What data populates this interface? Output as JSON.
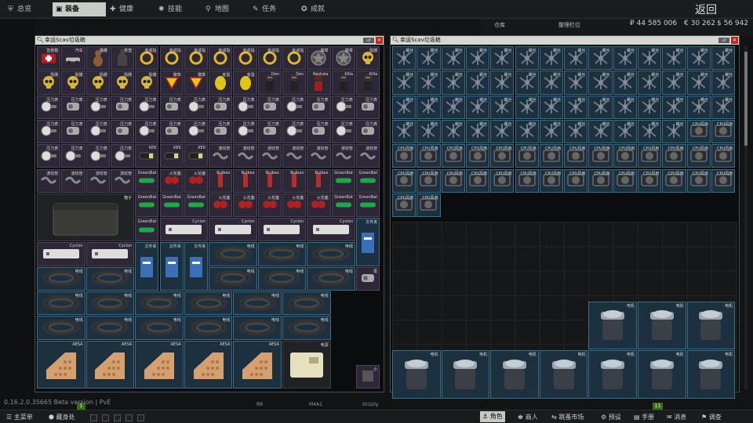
{
  "topbar": {
    "tabs": [
      {
        "label": "总览",
        "icon": "shield-icon"
      },
      {
        "label": "装备",
        "icon": "shirt-icon"
      },
      {
        "label": "健康",
        "icon": "health-icon"
      },
      {
        "label": "技能",
        "icon": "skills-icon"
      },
      {
        "label": "地图",
        "icon": "map-pin-icon"
      },
      {
        "label": "任务",
        "icon": "tasks-icon"
      },
      {
        "label": "成就",
        "icon": "achievements-icon"
      }
    ],
    "back": "返回"
  },
  "currency": {
    "rub": "₽ 44 585 006",
    "eur": "€ 30 262",
    "usd": "$ 56 942"
  },
  "stash": {
    "title": "仓库",
    "sort": "整理栏位"
  },
  "left_window": {
    "title": "幸运Scav垃圾箱",
    "btn": "off"
  },
  "right_window": {
    "title": "幸运Scav垃圾箱",
    "btn": "off"
  },
  "items": {
    "aid": "急救箱",
    "car": "汽车",
    "cat": "猫雕",
    "vase": "茶壶",
    "ring": "金戒指",
    "badge": "徽章",
    "skull": "骷髅",
    "egg": "金蛋",
    "figs": [
      "Den",
      "Den",
      "Reshala",
      "Killa",
      "Killa"
    ],
    "gauge": "压力表",
    "pump": "泵",
    "kek": "KEK",
    "hose": "波纹管",
    "bulb": "Bulbex",
    "sensor": "传感器",
    "plug": "火花塞",
    "green": "GreenBat",
    "chest": "箱子",
    "cyclon": "Cyclon",
    "cable": "电线",
    "folder": "文件夹",
    "aesa": "AESA",
    "power": "电源",
    "screw": "螺丝",
    "cpu": "CPU风扇",
    "motor": "电机",
    "small": "小"
  },
  "footer": {
    "version": "0.16.2.0.35665 Beta version | PvE",
    "slots": [
      "RR",
      "M4A1",
      "Grizzly"
    ],
    "menu": "主菜单",
    "hideout": "藏身处",
    "nav": [
      "角色",
      "商人",
      "跳蚤市场",
      "预设",
      "手册",
      "消息",
      "调查"
    ],
    "badge_left": "1",
    "badge_right": "11"
  },
  "colors": {
    "accent": "#c9cbc6",
    "danger": "#c0281c",
    "blue_cell": "#1d3040",
    "badge": "#3a6e1c"
  }
}
